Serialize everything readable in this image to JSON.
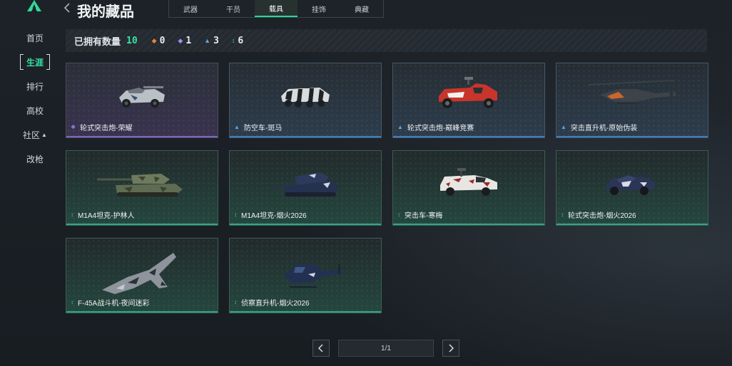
{
  "header": {
    "title": "我的藏品",
    "tabs": [
      {
        "label": "武器",
        "active": false
      },
      {
        "label": "干员",
        "active": false
      },
      {
        "label": "载具",
        "active": true
      },
      {
        "label": "挂饰",
        "active": false
      },
      {
        "label": "典藏",
        "active": false
      }
    ]
  },
  "sidebar": {
    "items": [
      {
        "label": "首页",
        "active": false
      },
      {
        "label": "生涯",
        "active": true
      },
      {
        "label": "排行",
        "active": false
      },
      {
        "label": "高校",
        "active": false
      },
      {
        "label": "社区",
        "active": false,
        "expandable": true
      },
      {
        "label": "改枪",
        "active": false
      }
    ]
  },
  "stats": {
    "label": "已拥有数量",
    "total": "10",
    "items": [
      {
        "icon": "orange-diamond-icon",
        "color": "#e8833a",
        "value": "0"
      },
      {
        "icon": "purple-diamond-icon",
        "color": "#a78cf0",
        "value": "1"
      },
      {
        "icon": "blue-chevron-icon",
        "color": "#5aa6ea",
        "value": "3"
      },
      {
        "icon": "green-arrows-icon",
        "color": "#39d6a0",
        "value": "6"
      }
    ]
  },
  "vehicles": [
    {
      "name": "轮式突击炮-荣耀",
      "rarity": "purple"
    },
    {
      "name": "防空车-斑马",
      "rarity": "blue"
    },
    {
      "name": "轮式突击炮-巅峰竞赛",
      "rarity": "blue"
    },
    {
      "name": "突击直升机-原始伪装",
      "rarity": "blue"
    },
    {
      "name": "M1A4坦克-护林人",
      "rarity": "green"
    },
    {
      "name": "M1A4坦克-烟火2026",
      "rarity": "green"
    },
    {
      "name": "突击车-寒梅",
      "rarity": "green"
    },
    {
      "name": "轮式突击炮-烟火2026",
      "rarity": "green"
    },
    {
      "name": "F-45A战斗机-夜间迷彩",
      "rarity": "green"
    },
    {
      "name": "侦察直升机-烟火2026",
      "rarity": "green"
    }
  ],
  "pagination": {
    "indicator": "1/1",
    "prev_icon": "chevron-left-icon",
    "next_icon": "chevron-right-icon"
  },
  "colors": {
    "accent": "#2fd69a",
    "purple": "#7b69c0",
    "blue": "#3f7fbf",
    "green": "#2ea886"
  }
}
